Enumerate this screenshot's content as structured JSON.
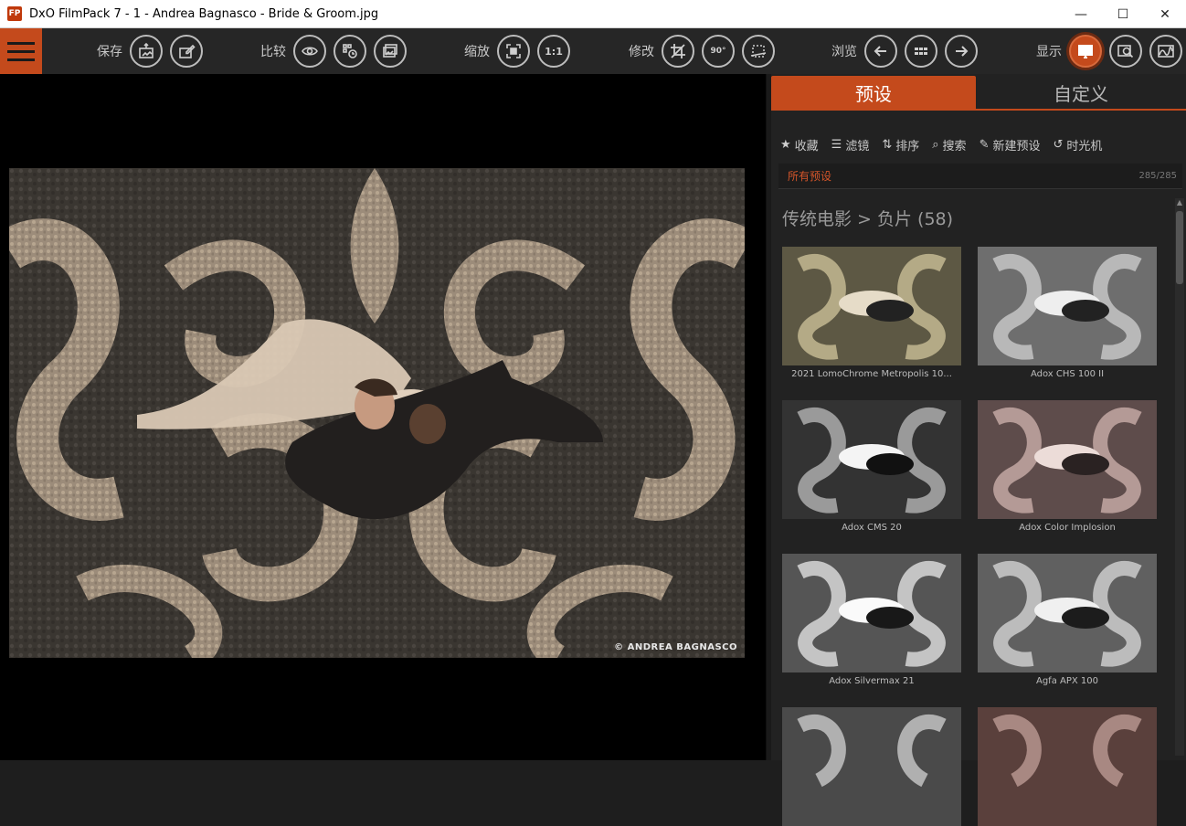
{
  "window": {
    "app_icon_label": "FP",
    "title": "DxO FilmPack 7 - 1 - Andrea Bagnasco - Bride & Groom.jpg",
    "minimize": "—",
    "maximize": "☐",
    "close": "✕"
  },
  "toolbar": {
    "save_label": "保存",
    "compare_label": "比较",
    "zoom_label": "缩放",
    "zoom_1to1": "1:1",
    "edit_label": "修改",
    "rotate_label": "90°",
    "browse_label": "浏览",
    "display_label": "显示"
  },
  "viewer": {
    "copyright": "© ANDREA BAGNASCO"
  },
  "panel": {
    "tabs": [
      {
        "label": "预设",
        "active": true
      },
      {
        "label": "自定义",
        "active": false
      }
    ],
    "actions": [
      {
        "icon": "star-icon",
        "glyph": "★",
        "label": "收藏"
      },
      {
        "icon": "list-icon",
        "glyph": "☰",
        "label": "滤镜"
      },
      {
        "icon": "sort-icon",
        "glyph": "⇅",
        "label": "排序"
      },
      {
        "icon": "search-icon",
        "glyph": "⌕",
        "label": "搜索"
      },
      {
        "icon": "new-preset-icon",
        "glyph": "✎",
        "label": "新建预设"
      },
      {
        "icon": "time-machine-icon",
        "glyph": "↺",
        "label": "时光机"
      }
    ],
    "filter_label": "所有预设",
    "filter_count": "285/285",
    "section_title": "传统电影 > 负片 (58)",
    "presets": [
      {
        "name": "2021 LomoChrome Metropolis 10...",
        "tone": "#8a8568"
      },
      {
        "name": "Adox CHS 100 II",
        "tone": "#8c8c8c"
      },
      {
        "name": "Adox CMS 20",
        "tone": "#5a5a5a"
      },
      {
        "name": "Adox Color Implosion",
        "tone": "#8a7472"
      },
      {
        "name": "Adox Silvermax 21",
        "tone": "#7a7a7a"
      },
      {
        "name": "Agfa APX 100",
        "tone": "#858585"
      },
      {
        "name": "",
        "tone": "#6c6c6c"
      },
      {
        "name": "",
        "tone": "#7a5c58"
      }
    ]
  },
  "colors": {
    "accent": "#c44a1c",
    "toolbar_bg": "#262626",
    "panel_bg": "#222222"
  }
}
